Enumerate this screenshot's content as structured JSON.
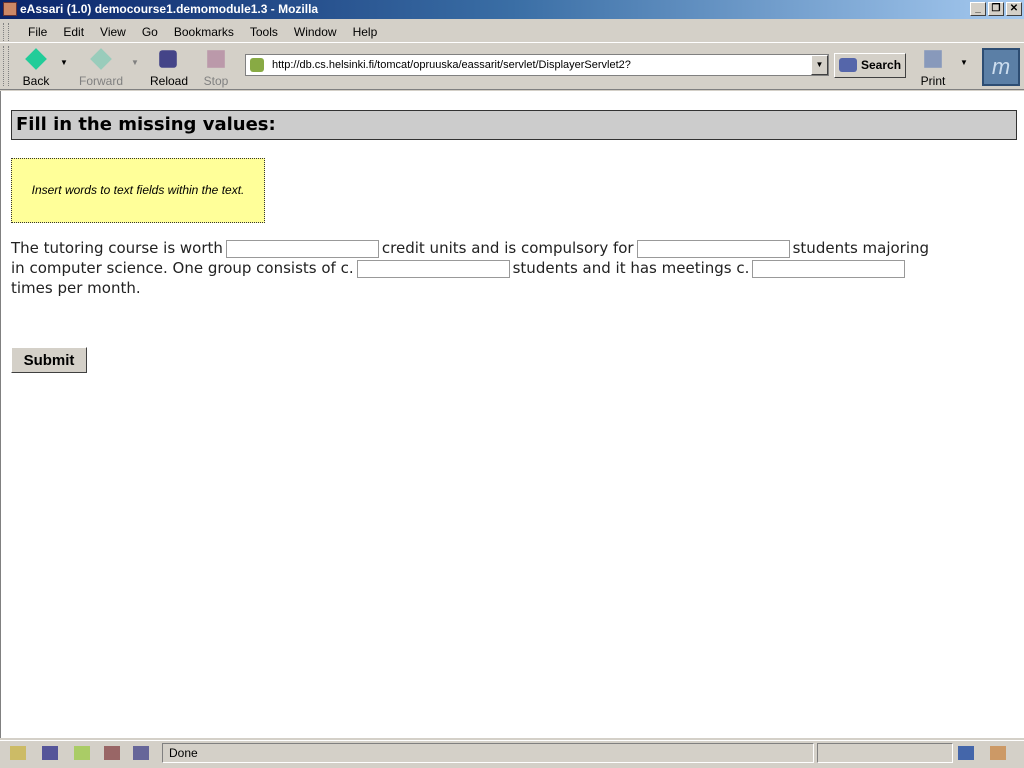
{
  "window": {
    "title": "eAssari (1.0) democourse1.demomodule1.3 - Mozilla",
    "controls": [
      "_",
      "❐",
      "✕"
    ]
  },
  "menu": [
    "File",
    "Edit",
    "View",
    "Go",
    "Bookmarks",
    "Tools",
    "Window",
    "Help"
  ],
  "toolbar": {
    "back": "Back",
    "forward": "Forward",
    "reload": "Reload",
    "stop": "Stop",
    "url": "http://db.cs.helsinki.fi/tomcat/opruuska/eassarit/servlet/DisplayerServlet2?",
    "search": "Search",
    "print": "Print"
  },
  "page": {
    "heading": "Fill in the missing values:",
    "instruction": "Insert words to text fields within the text.",
    "text": {
      "s1": "The tutoring course is worth",
      "s2": "credit units and is compulsory for",
      "s3": "students majoring",
      "s4": "in computer science. One group consists of c.",
      "s5": "students and it has meetings c.",
      "s6": "times per month."
    },
    "fields": [
      "",
      "",
      "",
      ""
    ],
    "submit": "Submit"
  },
  "status": {
    "text": "Done"
  }
}
